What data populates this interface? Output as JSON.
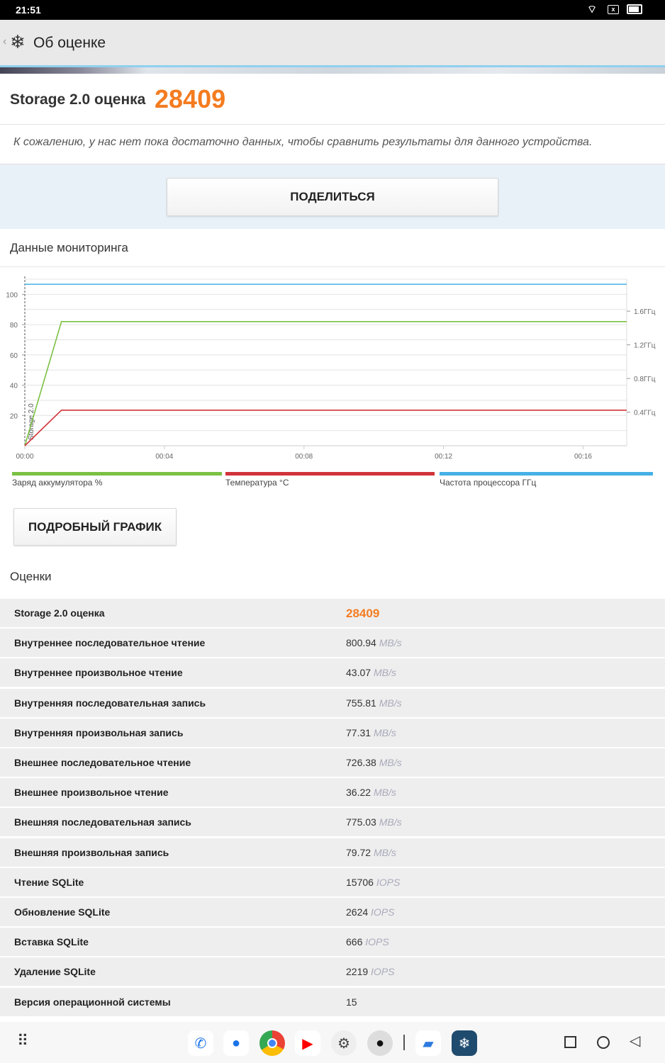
{
  "status": {
    "time": "21:51"
  },
  "appbar": {
    "title": "Об оценке"
  },
  "score": {
    "label": "Storage 2.0 оценка",
    "value": "28409",
    "note": "К сожалению, у нас нет пока достаточно данных, чтобы сравнить результаты для данного устройства."
  },
  "share_label": "ПОДЕЛИТЬСЯ",
  "monitoring": {
    "title": "Данные мониторинга",
    "detail_button": "ПОДРОБНЫЙ ГРАФИК"
  },
  "chart_data": {
    "type": "line",
    "x_ticks": [
      "00:00",
      "00:04",
      "00:08",
      "00:12",
      "00:16"
    ],
    "x_range_min": [
      0,
      17.25
    ],
    "y_left_ticks": [
      "20",
      "40",
      "60",
      "80",
      "100"
    ],
    "y_left_range": [
      0,
      110
    ],
    "y_right_ticks": [
      "0.4ГГц",
      "0.8ГГц",
      "1.2ГГц",
      "1.6ГГц"
    ],
    "y_right_range_ghz": [
      0,
      1.98
    ],
    "marker_label": "Storage 2.0",
    "series": [
      {
        "name": "Заряд аккумулятора %",
        "color": "#7bc043",
        "axis": "left",
        "x": [
          0,
          1.05,
          17.25
        ],
        "y": [
          0,
          82,
          82
        ]
      },
      {
        "name": "Температура °C",
        "color": "#d0343a",
        "axis": "left",
        "x": [
          0,
          1.05,
          17.25
        ],
        "y": [
          0,
          23.5,
          23.5
        ]
      },
      {
        "name": "Частота процессора ГГц",
        "color": "#45b0e5",
        "axis": "right",
        "x": [
          0,
          17.25
        ],
        "y": [
          1.92,
          1.92
        ]
      }
    ]
  },
  "scores": {
    "title": "Оценки",
    "rows": [
      {
        "label": "Storage 2.0 оценка",
        "value": "28409",
        "unit": ""
      },
      {
        "label": "Внутреннее последовательное чтение",
        "value": "800.94",
        "unit": "MB/s"
      },
      {
        "label": "Внутреннее произвольное чтение",
        "value": "43.07",
        "unit": "MB/s"
      },
      {
        "label": "Внутренняя последовательная запись",
        "value": "755.81",
        "unit": "MB/s"
      },
      {
        "label": "Внутренняя произвольная запись",
        "value": "77.31",
        "unit": "MB/s"
      },
      {
        "label": "Внешнее последовательное чтение",
        "value": "726.38",
        "unit": "MB/s"
      },
      {
        "label": "Внешнее произвольное чтение",
        "value": "36.22",
        "unit": "MB/s"
      },
      {
        "label": "Внешняя последовательная запись",
        "value": "775.03",
        "unit": "MB/s"
      },
      {
        "label": "Внешняя произвольная запись",
        "value": "79.72",
        "unit": "MB/s"
      },
      {
        "label": "Чтение SQLite",
        "value": "15706",
        "unit": "IOPS"
      },
      {
        "label": "Обновление SQLite",
        "value": "2624",
        "unit": "IOPS"
      },
      {
        "label": "Вставка SQLite",
        "value": "666",
        "unit": "IOPS"
      },
      {
        "label": "Удаление SQLite",
        "value": "2219",
        "unit": "IOPS"
      },
      {
        "label": "Версия операционной системы",
        "value": "15",
        "unit": ""
      }
    ]
  },
  "colors": {
    "accent": "#f47c20"
  }
}
